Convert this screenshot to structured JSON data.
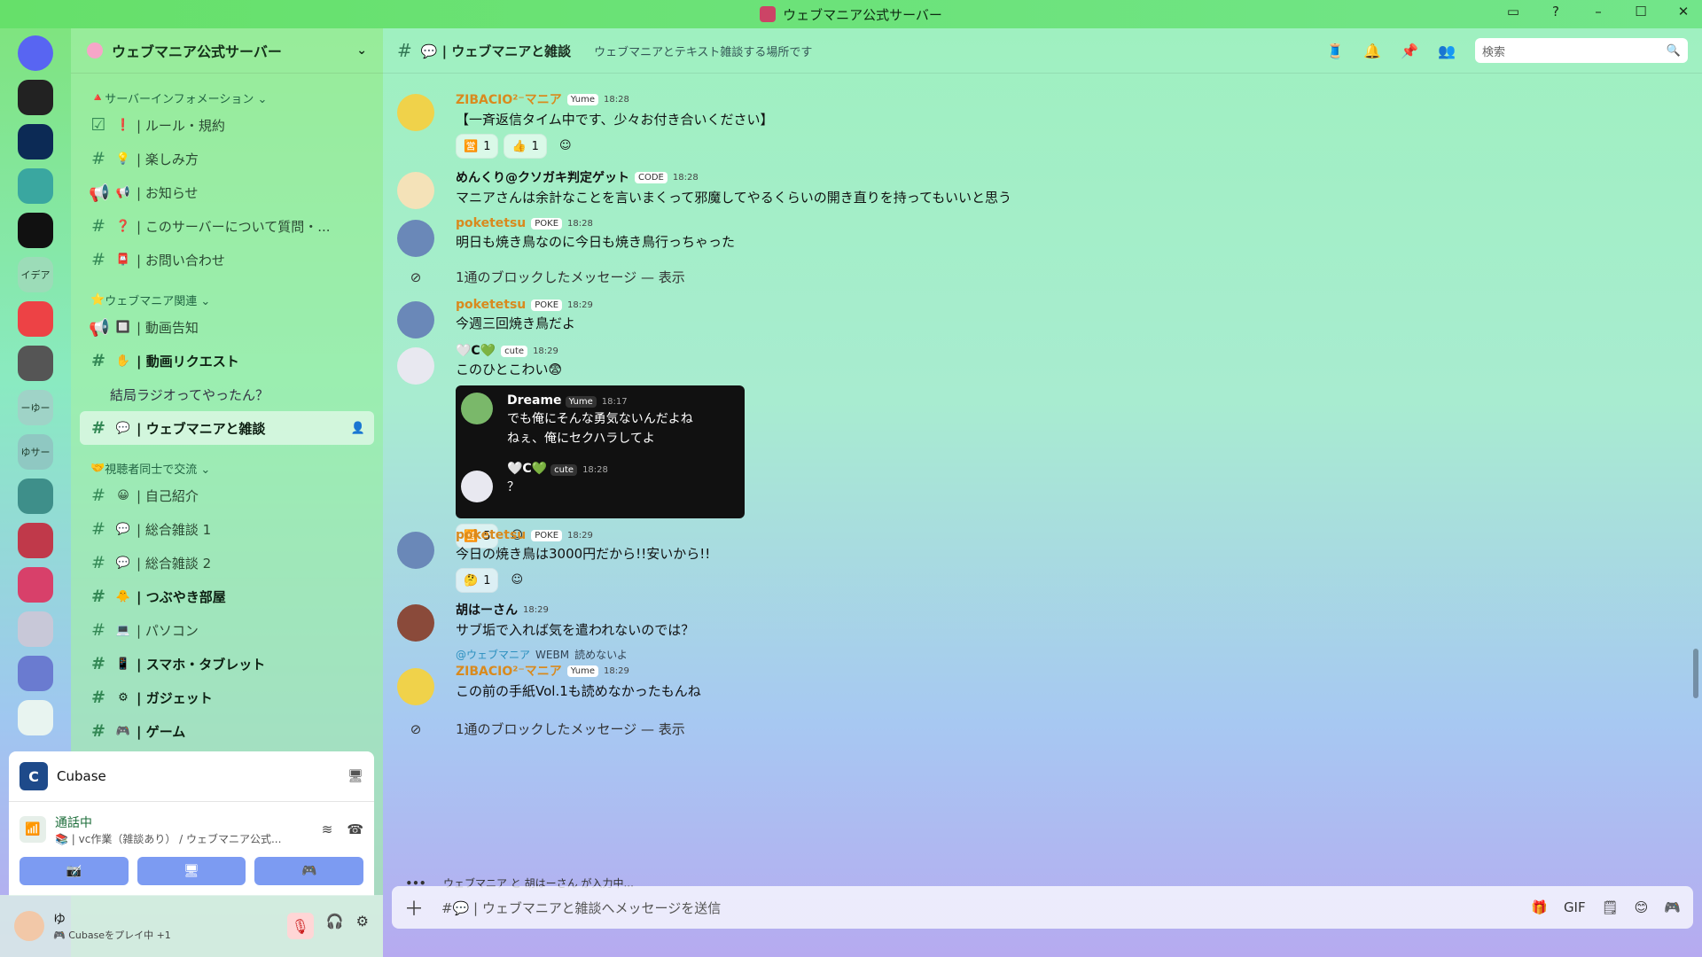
{
  "window": {
    "title": "ウェブマニア公式サーバー",
    "controls": [
      "▭",
      "?",
      "–",
      "☐",
      "✕"
    ]
  },
  "servers": [
    {
      "label": "",
      "color": "#5865f2"
    },
    {
      "label": "",
      "color": "#222222"
    },
    {
      "label": "",
      "color": "#0c2a55"
    },
    {
      "label": "",
      "color": "#3aa7a0"
    },
    {
      "label": "",
      "color": "#111111"
    },
    {
      "label": "イデア",
      "color": "#9cdcb8"
    },
    {
      "label": "",
      "color": "#ed4245"
    },
    {
      "label": "",
      "color": "#555555"
    },
    {
      "label": "ーゆー",
      "color": "#9fd3c7"
    },
    {
      "label": "ゆサー",
      "color": "#8fc8c2"
    },
    {
      "label": "",
      "color": "#3e8f8a"
    },
    {
      "label": "",
      "color": "#c0394a"
    },
    {
      "label": "",
      "color": "#d8406a"
    },
    {
      "label": "",
      "color": "#c8c8d8"
    },
    {
      "label": "",
      "color": "#6a7bd0"
    },
    {
      "label": "",
      "color": "#e8f4f0"
    }
  ],
  "sidebar": {
    "server_name": "ウェブマニア公式サーバー",
    "categories": [
      {
        "label": "サーバーインフォメーション ⌄",
        "prefix": "🔺"
      },
      {
        "label": "ウェブマニア関連 ⌄",
        "prefix": "⭐"
      },
      {
        "label": "視聴者同士で交流 ⌄",
        "prefix": "🤝"
      }
    ],
    "channels": [
      {
        "name": "| ルール・規約",
        "emoji": "❗",
        "icon": "☑"
      },
      {
        "name": "| 楽しみ方",
        "emoji": "💡",
        "icon": "#"
      },
      {
        "name": "| お知らせ",
        "emoji": "📢",
        "icon": "📢"
      },
      {
        "name": "| このサーバーについて質問・...",
        "emoji": "❓",
        "icon": "#"
      },
      {
        "name": "| お問い合わせ",
        "emoji": "📮",
        "icon": "#"
      },
      {
        "name": "| 動画告知",
        "emoji": "🔲",
        "icon": "📢"
      },
      {
        "name": "| 動画リクエスト",
        "emoji": "✋",
        "icon": "#"
      },
      {
        "name": "結局ラジオってやったん？",
        "emoji": "",
        "icon": ""
      },
      {
        "name": "| ウェブマニアと雑談",
        "emoji": "💬",
        "icon": "#"
      },
      {
        "name": "| 自己紹介",
        "emoji": "😀",
        "icon": "#"
      },
      {
        "name": "| 総合雑談 1",
        "emoji": "💬",
        "icon": "#"
      },
      {
        "name": "| 総合雑談 2",
        "emoji": "💬",
        "icon": "#"
      },
      {
        "name": "| つぶやき部屋",
        "emoji": "🐥",
        "icon": "#"
      },
      {
        "name": "| パソコン",
        "emoji": "💻",
        "icon": "#"
      },
      {
        "name": "| スマホ・タブレット",
        "emoji": "📱",
        "icon": "#"
      },
      {
        "name": "| ガジェット",
        "emoji": "⚙",
        "icon": "#"
      },
      {
        "name": "| ゲーム",
        "emoji": "🎮",
        "icon": "#"
      }
    ]
  },
  "activity": {
    "app": "Cubase",
    "app_icon_letter": "C",
    "voice_status": "通話中",
    "voice_channel": "📚 | vc作業（雑談あり） / ウェブマニア公式...",
    "buttons": [
      "📷̸",
      "🖥",
      "🎮"
    ]
  },
  "user": {
    "name": "ゆ",
    "status": "🎮 Cubaseをプレイ中 +1",
    "controls": [
      "🎙",
      "🎧",
      "⚙"
    ]
  },
  "channel_header": {
    "name": "💬 | ウェブマニアと雑談",
    "topic": "ウェブマニアとテキスト雑談する場所です",
    "tools": [
      "🧵",
      "🔔",
      "📌",
      "👥"
    ],
    "search_placeholder": "検索"
  },
  "messages": [
    {
      "user": "ZIBACIO²⁻マニア",
      "user_color": "#d98a1e",
      "tag": "Yume",
      "time": "18:28",
      "text": "【一斉返信タイム中です、少々お付き合いください】",
      "reactions": [
        {
          "emoji": "🈺",
          "count": "1"
        },
        {
          "emoji": "👍",
          "count": "1"
        }
      ],
      "avatar_color": "#f0d24a"
    },
    {
      "user": "めんくり@クソガキ判定ゲット",
      "user_color": "#111111",
      "tag": "CODE",
      "time": "18:28",
      "text": "マニアさんは余計なことを言いまくって邪魔してやるくらいの開き直りを持ってもいいと思う",
      "avatar_color": "#f4e2b8"
    },
    {
      "user": "poketetsu",
      "user_color": "#d98a1e",
      "tag": "POKE",
      "time": "18:28",
      "text": "明日も焼き鳥なのに今日も焼き鳥行っちゃった",
      "avatar_color": "#6a88b8"
    },
    {
      "blocked": "1通のブロックしたメッセージ — 表示"
    },
    {
      "user": "poketetsu",
      "user_color": "#d98a1e",
      "tag": "POKE",
      "time": "18:29",
      "text": "今週三回焼き鳥だよ",
      "avatar_color": "#6a88b8"
    },
    {
      "user": "🤍C💚",
      "user_color": "#111111",
      "tag": "cute",
      "time": "18:29",
      "text": "このひとこわい😨",
      "avatar_color": "#e8e8f0",
      "embed": [
        {
          "user": "Dreame",
          "tag": "Yume",
          "time": "18:17",
          "text": [
            "でも俺にそんな勇気ないんだよね",
            "ねぇ、俺にセクハラしてよ"
          ],
          "avatar_color": "#7ab86a"
        },
        {
          "user": "🤍C💚",
          "tag": "cute",
          "time": "18:28",
          "text": [
            "？"
          ],
          "avatar_color": "#e8e8f0"
        }
      ],
      "reactions": [
        {
          "emoji": "🈺",
          "count": "5"
        }
      ]
    },
    {
      "user": "poketetsu",
      "user_color": "#d98a1e",
      "tag": "POKE",
      "time": "18:29",
      "text": "今日の焼き鳥は3000円だから!!安いから!!",
      "reactions": [
        {
          "emoji": "🤔",
          "count": "1"
        }
      ],
      "avatar_color": "#6a88b8"
    },
    {
      "user": "胡はーさん",
      "user_color": "#111111",
      "tag": "",
      "time": "18:29",
      "text": "サブ垢で入れば気を遣われないのでは？",
      "avatar_color": "#8a4a3a"
    },
    {
      "reply_to": "@ウェブマニア",
      "reply_tag": "WEBM",
      "reply_text": "読めないよ",
      "user": "ZIBACIO²⁻マニア",
      "user_color": "#d98a1e",
      "tag": "Yume",
      "time": "18:29",
      "text": "この前の手紙Vol.1も読めなかったもんね",
      "avatar_color": "#f0d24a"
    },
    {
      "blocked": "1通のブロックしたメッセージ — 表示"
    }
  ],
  "typing": {
    "users": "ウェブマニア と 胡はーさん が入力中..."
  },
  "composer": {
    "placeholder": "#💬 | ウェブマニアと雑談へメッセージを送信",
    "tools": [
      "🎁",
      "GIF",
      "🗒",
      "😊",
      "🎮"
    ]
  }
}
